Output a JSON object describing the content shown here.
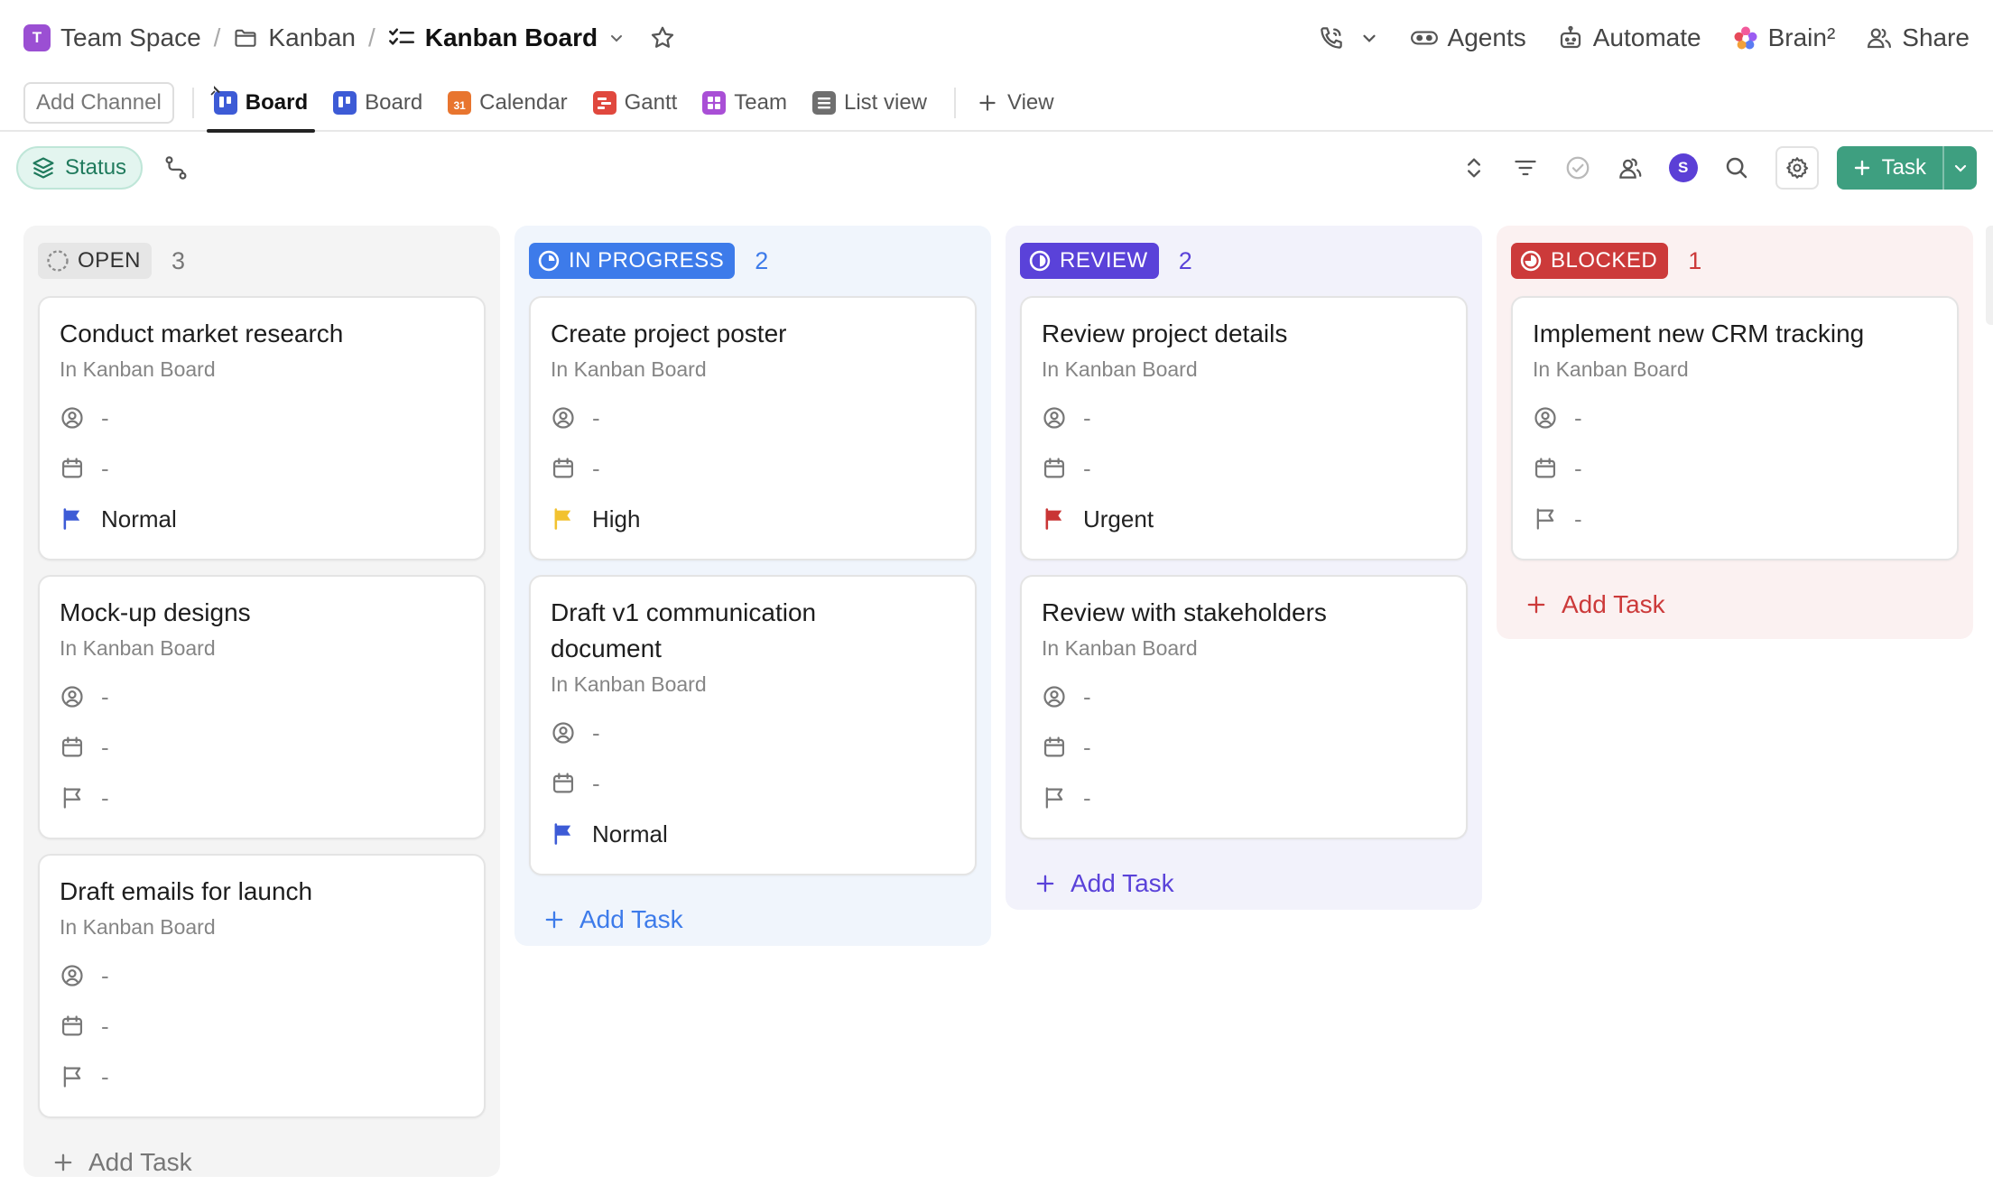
{
  "breadcrumb": {
    "space_badge": "T",
    "space": "Team Space",
    "folder": "Kanban",
    "list": "Kanban Board"
  },
  "top_actions": {
    "agents": "Agents",
    "automate": "Automate",
    "brain": "Brain²",
    "share": "Share"
  },
  "tabs": {
    "add_channel": "Add Channel",
    "board_active": "Board",
    "board": "Board",
    "calendar": "Calendar",
    "calendar_day": "31",
    "gantt": "Gantt",
    "team": "Team",
    "list_view": "List view",
    "add_view": "View"
  },
  "toolbar": {
    "group_by": "Status",
    "avatar_initial": "S",
    "new_task": "Task"
  },
  "colors": {
    "open": "#e6e6e6",
    "in_progress": "#3d7bea",
    "review": "#5a42d9",
    "blocked": "#cc3a3a",
    "accent_green": "#3e9f80",
    "flag_normal": "#3d5bd6",
    "flag_high": "#f2c230",
    "flag_urgent": "#c93535"
  },
  "columns": {
    "open": {
      "label": "OPEN",
      "count": "3",
      "add_task": "Add Task",
      "cards": [
        {
          "title": "Conduct market research",
          "location": "In Kanban Board",
          "assignee": "-",
          "date": "-",
          "priority": "Normal"
        },
        {
          "title": "Mock-up designs",
          "location": "In Kanban Board",
          "assignee": "-",
          "date": "-",
          "priority": "-"
        },
        {
          "title": "Draft emails for launch",
          "location": "In Kanban Board",
          "assignee": "-",
          "date": "-",
          "priority": "-"
        }
      ]
    },
    "in_progress": {
      "label": "IN PROGRESS",
      "count": "2",
      "add_task": "Add Task",
      "cards": [
        {
          "title": "Create project poster",
          "location": "In Kanban Board",
          "assignee": "-",
          "date": "-",
          "priority": "High"
        },
        {
          "title": "Draft v1 communication document",
          "location": "In Kanban Board",
          "assignee": "-",
          "date": "-",
          "priority": "Normal"
        }
      ]
    },
    "review": {
      "label": "REVIEW",
      "count": "2",
      "add_task": "Add Task",
      "cards": [
        {
          "title": "Review project details",
          "location": "In Kanban Board",
          "assignee": "-",
          "date": "-",
          "priority": "Urgent"
        },
        {
          "title": "Review with stakeholders",
          "location": "In Kanban Board",
          "assignee": "-",
          "date": "-",
          "priority": "-"
        }
      ]
    },
    "blocked": {
      "label": "BLOCKED",
      "count": "1",
      "add_task": "Add Task",
      "cards": [
        {
          "title": "Implement new CRM tracking",
          "location": "In Kanban Board",
          "assignee": "-",
          "date": "-",
          "priority": "-"
        }
      ]
    }
  }
}
